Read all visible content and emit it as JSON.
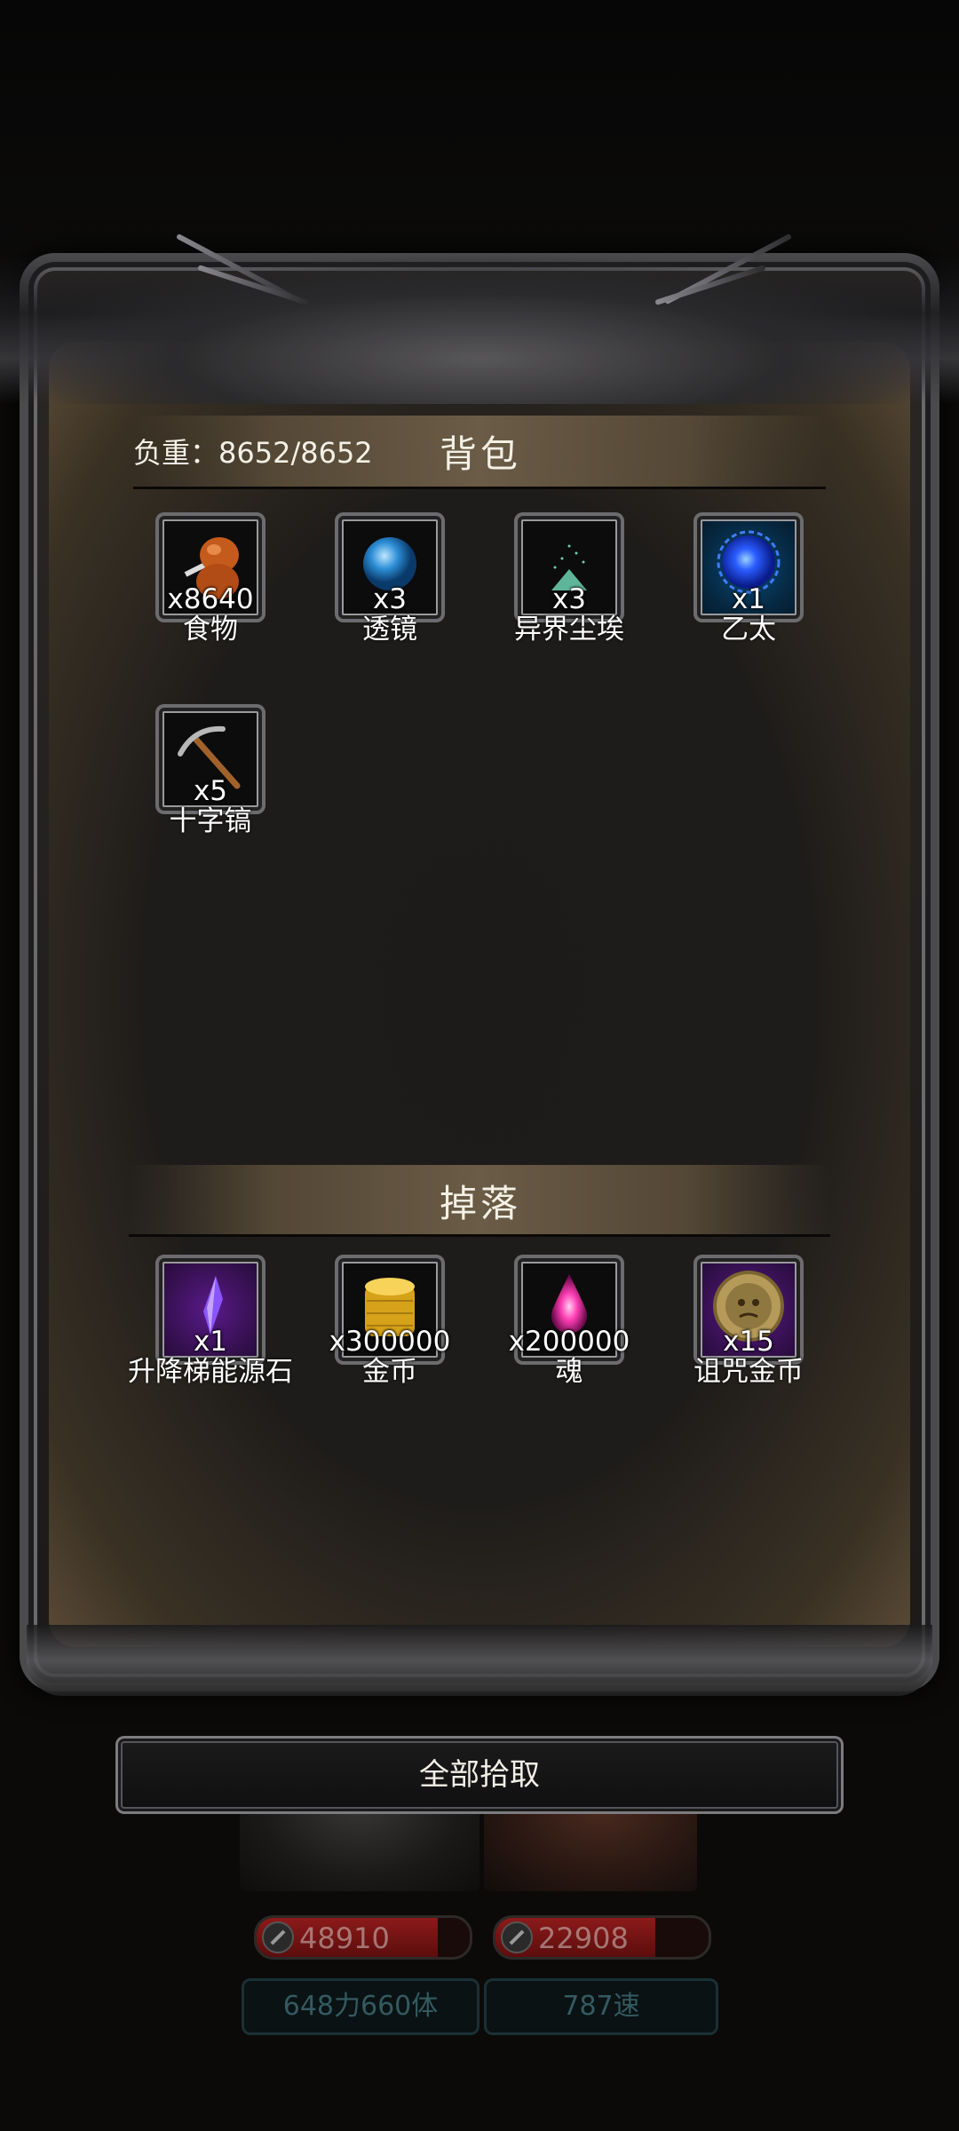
{
  "characters": [
    {
      "hp": "48910",
      "hp_fraction": 0.85,
      "stats": "648力660体"
    },
    {
      "hp": "22908",
      "hp_fraction": 0.75,
      "stats": "787速"
    }
  ],
  "panel": {
    "weight": "负重：8652/8652",
    "backpack_title": "背包",
    "drops_title": "掉落",
    "backpack_items": [
      {
        "qty": "x8640",
        "name": "食物",
        "icon": "food-icon"
      },
      {
        "qty": "x3",
        "name": "透镜",
        "icon": "lens-icon"
      },
      {
        "qty": "x3",
        "name": "异界尘埃",
        "icon": "dust-icon"
      },
      {
        "qty": "x1",
        "name": "乙太",
        "icon": "ether-icon"
      },
      {
        "qty": "x5",
        "name": "十字镐",
        "icon": "pickaxe-icon"
      }
    ],
    "drop_items": [
      {
        "qty": "x1",
        "name": "升降梯能源石",
        "icon": "crystal-icon"
      },
      {
        "qty": "x300000",
        "name": "金币",
        "icon": "gold-coins-icon"
      },
      {
        "qty": "x200000",
        "name": "魂",
        "icon": "soul-icon"
      },
      {
        "qty": "x15",
        "name": "诅咒金币",
        "icon": "cursed-coin-icon"
      }
    ]
  },
  "actions": {
    "pick_all": "全部拾取"
  }
}
